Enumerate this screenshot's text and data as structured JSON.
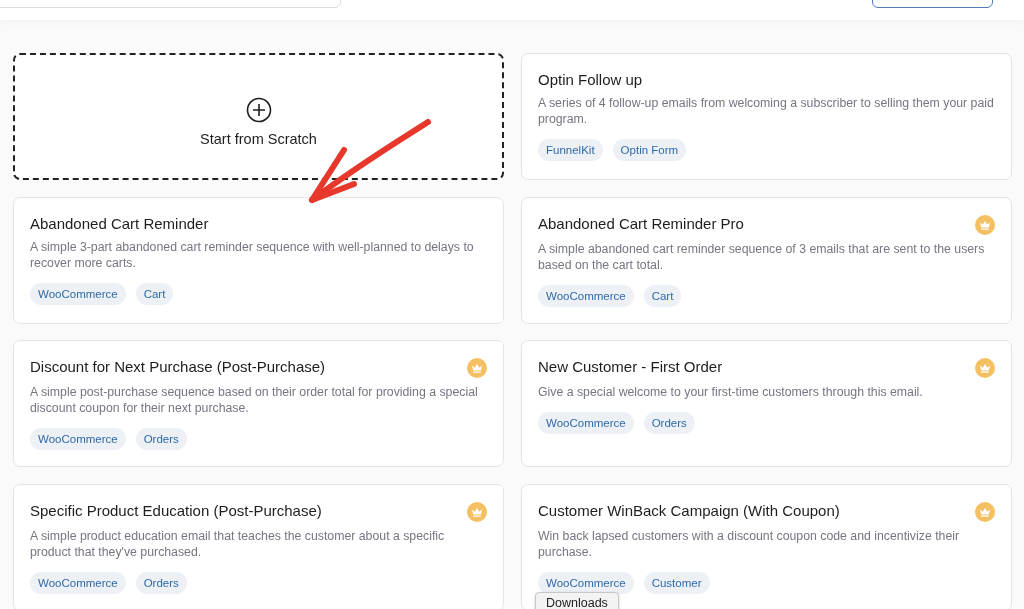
{
  "templates": [
    {
      "kind": "scratch",
      "title": "Start from Scratch"
    },
    {
      "kind": "template",
      "title": "Optin Follow up",
      "description": "A series of 4 follow-up emails from welcoming a subscriber to selling them your paid program.",
      "pro": false,
      "tags": [
        "FunnelKit",
        "Optin Form"
      ]
    },
    {
      "kind": "template",
      "title": "Abandoned Cart Reminder",
      "description": "A simple 3-part abandoned cart reminder sequence with well-planned to delays to recover more carts.",
      "pro": false,
      "tags": [
        "WooCommerce",
        "Cart"
      ]
    },
    {
      "kind": "template",
      "title": "Abandoned Cart Reminder Pro",
      "description": "A simple abandoned cart reminder sequence of 3 emails that are sent to the users based on the cart total.",
      "pro": true,
      "tags": [
        "WooCommerce",
        "Cart"
      ]
    },
    {
      "kind": "template",
      "title": "Discount for Next Purchase (Post-Purchase)",
      "description": "A simple post-purchase sequence based on their order total for providing a special discount coupon for their next purchase.",
      "pro": true,
      "tags": [
        "WooCommerce",
        "Orders"
      ]
    },
    {
      "kind": "template",
      "title": "New Customer - First Order",
      "description": "Give a special welcome to your first-time customers through this email.",
      "pro": true,
      "tags": [
        "WooCommerce",
        "Orders"
      ]
    },
    {
      "kind": "template",
      "title": "Specific Product Education (Post-Purchase)",
      "description": "A simple product education email that teaches the customer about a specific product that they've purchased.",
      "pro": true,
      "tags": [
        "WooCommerce",
        "Orders"
      ]
    },
    {
      "kind": "template",
      "title": "Customer WinBack Campaign (With Coupon)",
      "description": "Win back lapsed customers with a discount coupon code and incentivize their purchase.",
      "pro": true,
      "tags": [
        "WooCommerce",
        "Customer"
      ]
    }
  ],
  "tooltip": "Downloads"
}
